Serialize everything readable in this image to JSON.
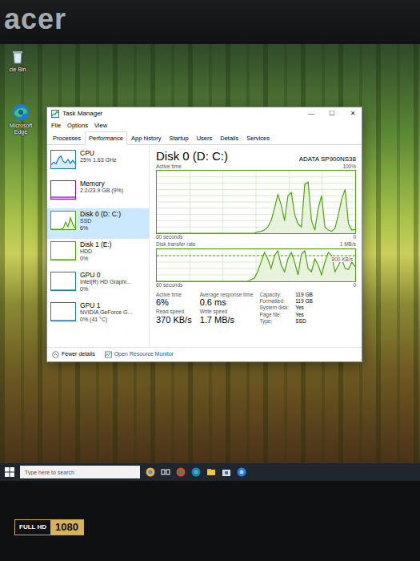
{
  "bezel": {
    "logo": "acer",
    "sticker_top": "FULL HD",
    "sticker_bottom": "1080"
  },
  "desktop_icons": [
    {
      "label": "cle Bin"
    },
    {
      "label": "Microsoft Edge"
    }
  ],
  "window": {
    "title": "Task Manager",
    "controls": [
      "—",
      "☐",
      "✕"
    ]
  },
  "menu": [
    "File",
    "Options",
    "View"
  ],
  "tabs": [
    {
      "label": "Processes",
      "selected": false
    },
    {
      "label": "Performance",
      "selected": true
    },
    {
      "label": "App history",
      "selected": false
    },
    {
      "label": "Startup",
      "selected": false
    },
    {
      "label": "Users",
      "selected": false
    },
    {
      "label": "Details",
      "selected": false
    },
    {
      "label": "Services",
      "selected": false
    }
  ],
  "sidebar": {
    "items": [
      {
        "name": "CPU",
        "lines": [
          "25% 1.63 GHz"
        ],
        "selected": false,
        "color": "#117dbb",
        "graph": [
          20,
          35,
          25,
          55,
          70,
          40,
          30,
          50,
          28,
          45,
          25
        ]
      },
      {
        "name": "Memory",
        "lines": [
          "2.2/23.9 GB (9%)"
        ],
        "selected": false,
        "color": "#8b12ae",
        "graph": [
          9,
          9,
          9,
          9,
          9,
          9,
          9,
          9,
          9,
          9,
          9
        ]
      },
      {
        "name": "Disk 0 (D: C:)",
        "lines": [
          "SSD",
          "6%"
        ],
        "selected": true,
        "color": "#4da60c",
        "graph": [
          0,
          0,
          0,
          0,
          0,
          5,
          40,
          15,
          65,
          30,
          6
        ]
      },
      {
        "name": "Disk 1 (E:)",
        "lines": [
          "HDD",
          "0%"
        ],
        "selected": false,
        "color": "#4da60c",
        "graph": [
          0,
          0,
          0,
          0,
          0,
          0,
          0,
          0,
          0,
          0,
          0
        ]
      },
      {
        "name": "GPU 0",
        "lines": [
          "Intel(R) HD Graphi...",
          "0%"
        ],
        "selected": false,
        "color": "#117dbb",
        "graph": [
          0,
          0,
          0,
          0,
          0,
          0,
          0,
          0,
          0,
          0,
          0
        ]
      },
      {
        "name": "GPU 1",
        "lines": [
          "NVIDIA GeForce G...",
          "0% (41 °C)"
        ],
        "selected": false,
        "color": "#117dbb",
        "graph": [
          0,
          0,
          0,
          0,
          0,
          0,
          0,
          0,
          0,
          0,
          0
        ]
      }
    ]
  },
  "detail": {
    "title": "Disk 0 (D: C:)",
    "model": "ADATA SP900NS38",
    "active_chart": {
      "label": "Active time",
      "max": "100%",
      "time": "60 seconds",
      "min": "0",
      "max_value": 100,
      "values": [
        0,
        0,
        0,
        0,
        0,
        0,
        0,
        0,
        0,
        0,
        0,
        0,
        0,
        0,
        0,
        0,
        0,
        0,
        0,
        0,
        0,
        0,
        0,
        0,
        0,
        0,
        0,
        0,
        0,
        0,
        2,
        3,
        5,
        10,
        20,
        40,
        62,
        45,
        20,
        60,
        65,
        30,
        15,
        10,
        78,
        82,
        20,
        5,
        40,
        60,
        10,
        5,
        3,
        8,
        30,
        55,
        70,
        15,
        5,
        6
      ]
    },
    "transfer_chart": {
      "label": "Disk transfer rate",
      "max": "1 MB/s",
      "mid": "800 KB/s",
      "mid_value": 800,
      "time": "60 seconds",
      "min": "0",
      "max_value": 1000,
      "values": [
        0,
        0,
        0,
        0,
        0,
        0,
        0,
        0,
        0,
        0,
        0,
        0,
        0,
        0,
        0,
        0,
        0,
        0,
        0,
        0,
        0,
        0,
        0,
        0,
        0,
        0,
        0,
        0,
        50,
        100,
        300,
        600,
        900,
        700,
        400,
        800,
        950,
        500,
        300,
        700,
        900,
        600,
        200,
        850,
        950,
        400,
        300,
        700,
        500,
        200,
        600,
        900,
        800,
        300,
        500,
        700,
        400,
        370,
        600,
        450
      ]
    },
    "stats": [
      {
        "label": "Active time",
        "value": "6%"
      },
      {
        "label": "Average response time",
        "value": "0.6 ms"
      },
      {
        "label": "Read speed",
        "value": "370 KB/s"
      },
      {
        "label": "Write speed",
        "value": "1.7 MB/s"
      }
    ],
    "properties": [
      {
        "label": "Capacity:",
        "value": "119 GB"
      },
      {
        "label": "Formatted:",
        "value": "119 GB"
      },
      {
        "label": "System disk:",
        "value": "Yes"
      },
      {
        "label": "Page file:",
        "value": "Yes"
      },
      {
        "label": "Type:",
        "value": "SSD"
      }
    ]
  },
  "footer": {
    "fewer": "Fewer details",
    "resource": "Open Resource Monitor"
  },
  "taskbar": {
    "search": {
      "placeholder": "Type here to search"
    }
  }
}
